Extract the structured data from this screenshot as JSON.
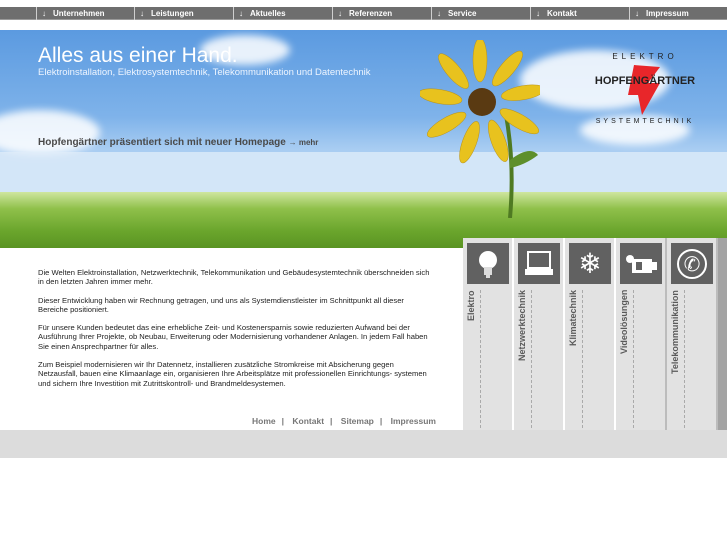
{
  "nav": {
    "items": [
      {
        "label": "Unternehmen"
      },
      {
        "label": "Leistungen"
      },
      {
        "label": "Aktuelles"
      },
      {
        "label": "Referenzen"
      },
      {
        "label": "Service"
      },
      {
        "label": "Kontakt"
      },
      {
        "label": "Impressum"
      }
    ],
    "arrow": "↓"
  },
  "hero": {
    "title": "Alles aus einer Hand.",
    "subtitle": "Elektroinstallation, Elektrosystemtechnik, Telekommunikation und Datentechnik",
    "news": "Hopfengärtner präsentiert sich mit neuer Homepage",
    "more": "→ mehr"
  },
  "logo": {
    "name": "HOPFENGÄRTNER",
    "top": "ELEKTRO",
    "bottom": "SYSTEMTECHNIK",
    "accent": "#e8262a"
  },
  "content": {
    "paragraphs": [
      "Die Welten Elektroinstallation, Netzwerktechnik, Telekommunikation und Gebäudesystemtechnik überschneiden sich in den letzten Jahren immer mehr.",
      "Dieser Entwicklung haben wir Rechnung getragen, und uns als Systemdienstleister im Schnittpunkt all dieser Bereiche positioniert.",
      "Für unsere Kunden bedeutet das eine erhebliche Zeit- und Kostenersparnis sowie reduzierten Aufwand bei der Ausführung Ihrer Projekte, ob Neubau, Erweiterung oder Modernisierung vorhandener Anlagen. In jedem Fall haben Sie einen Ansprechpartner für alles.",
      "Zum Beispiel modernisieren wir Ihr Datennetz, installieren zusätzliche Stromkreise mit Absicherung gegen Netzausfall, bauen eine Klimaanlage ein, organisieren Ihre Arbeitsplätze mit professionellen Einrichtungs- systemen und sichern Ihre Investition mit Zutrittskontroll- und Brandmeldesystemen."
    ]
  },
  "footer_links": [
    {
      "label": "Home"
    },
    {
      "label": "Kontakt"
    },
    {
      "label": "Sitemap"
    },
    {
      "label": "Impressum"
    }
  ],
  "footer_sep": "|",
  "services": [
    {
      "label": "Elektro",
      "icon": "lightbulb-icon"
    },
    {
      "label": "Netzwerktechnik",
      "icon": "laptop-icon"
    },
    {
      "label": "Klimatechnik",
      "icon": "snowflake-icon"
    },
    {
      "label": "Videolösungen",
      "icon": "video-camera-icon"
    },
    {
      "label": "Telekommunikation",
      "icon": "phone-icon"
    }
  ]
}
